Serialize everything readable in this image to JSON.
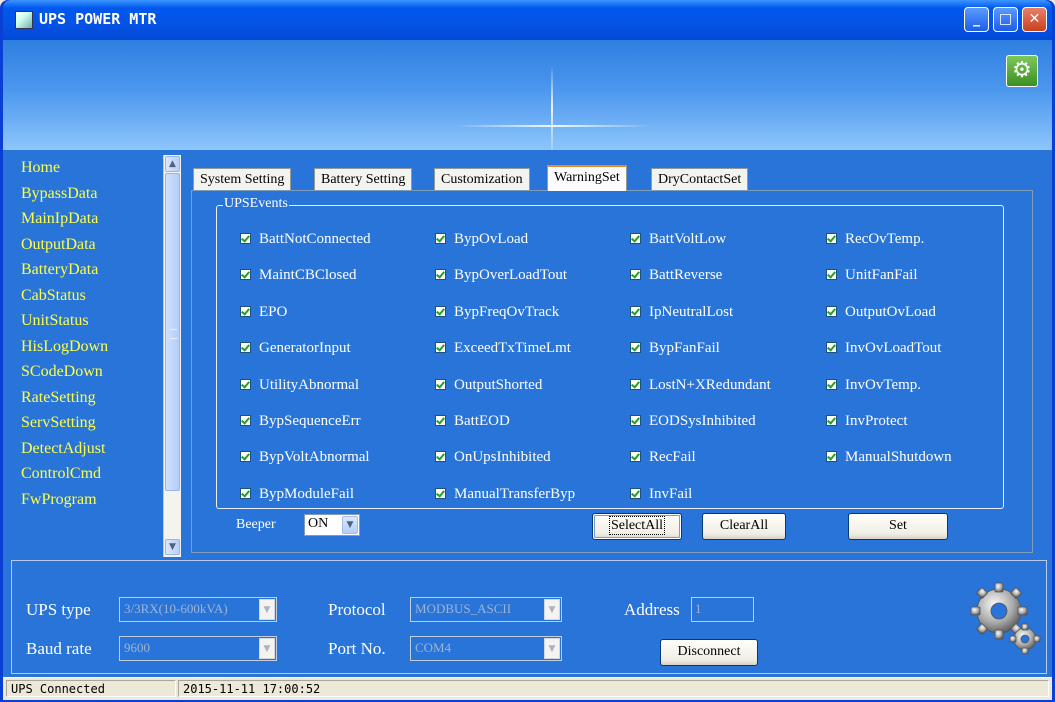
{
  "window": {
    "title": "UPS POWER MTR",
    "minimize": "_",
    "maximize": "□",
    "close": "✕"
  },
  "header": {
    "settings_icon": "gear-icon"
  },
  "sidebar": {
    "items": [
      "Home",
      "BypassData",
      "MainIpData",
      "OutputData",
      "BatteryData",
      "CabStatus",
      "UnitStatus",
      "HisLogDown",
      "SCodeDown",
      "RateSetting",
      "ServSetting",
      "DetectAdjust",
      "ControlCmd",
      "FwProgram"
    ]
  },
  "tabs": [
    {
      "label": "System Setting",
      "active": false
    },
    {
      "label": "Battery Setting",
      "active": false
    },
    {
      "label": "Customization",
      "active": false
    },
    {
      "label": "WarningSet",
      "active": true
    },
    {
      "label": "DryContactSet",
      "active": false
    }
  ],
  "ups_events": {
    "group_label": "UPSEvents",
    "columns": [
      [
        "BattNotConnected",
        "MaintCBClosed",
        "EPO",
        "GeneratorInput",
        "UtilityAbnormal",
        "BypSequenceErr",
        "BypVoltAbnormal",
        "BypModuleFail"
      ],
      [
        "BypOvLoad",
        "BypOverLoadTout",
        "BypFreqOvTrack",
        "ExceedTxTimeLmt",
        "OutputShorted",
        "BattEOD",
        "OnUpsInhibited",
        "ManualTransferByp"
      ],
      [
        "BattVoltLow",
        "BattReverse",
        "IpNeutralLost",
        "BypFanFail",
        "LostN+XRedundant",
        "EODSysInhibited",
        "RecFail",
        "InvFail"
      ],
      [
        "RecOvTemp.",
        "UnitFanFail",
        "OutputOvLoad",
        "InvOvLoadTout",
        "InvOvTemp.",
        "InvProtect",
        "ManualShutdown"
      ]
    ],
    "all_checked": true
  },
  "controls": {
    "beeper_label": "Beeper",
    "beeper_value": "ON",
    "select_all": "SelectAll",
    "clear_all": "ClearAll",
    "set": "Set"
  },
  "connection": {
    "ups_type_label": "UPS type",
    "ups_type_value": "3/3RX(10-600kVA)",
    "protocol_label": "Protocol",
    "protocol_value": "MODBUS_ASCII",
    "address_label": "Address",
    "address_value": "1",
    "baud_rate_label": "Baud rate",
    "baud_rate_value": "9600",
    "port_label": "Port No.",
    "port_value": "COM4",
    "disconnect": "Disconnect"
  },
  "status_bar": {
    "connection": "UPS Connected",
    "datetime": "2015-11-11 17:00:52"
  }
}
